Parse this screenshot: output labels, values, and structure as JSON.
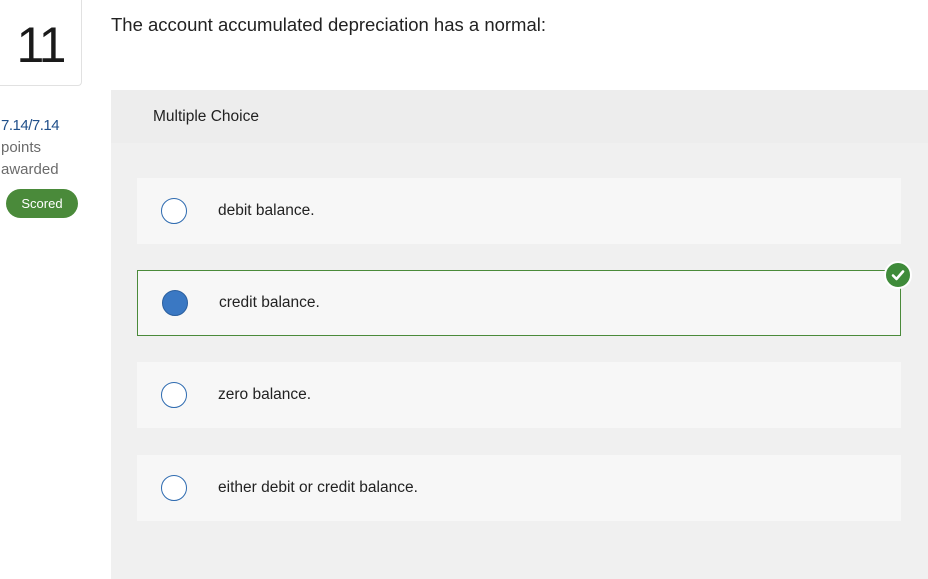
{
  "question": {
    "number": "11",
    "text": "The account accumulated depreciation has a normal:"
  },
  "score": {
    "points": "7.14/7.14",
    "label_line1": "points",
    "label_line2": "awarded",
    "status": "Scored"
  },
  "colors": {
    "scored_badge": "#4a8a3a",
    "correct_border": "#4a8a3a",
    "radio_selected": "#3a78c3",
    "points_text": "#1f4f8a"
  },
  "multiple_choice": {
    "title": "Multiple Choice",
    "options": [
      {
        "label": "debit balance.",
        "selected": false,
        "correct": false
      },
      {
        "label": "credit balance.",
        "selected": true,
        "correct": true
      },
      {
        "label": "zero balance.",
        "selected": false,
        "correct": false
      },
      {
        "label": "either debit or credit balance.",
        "selected": false,
        "correct": false
      }
    ]
  },
  "icons": {
    "correct_indicator": "check-circle-icon"
  }
}
